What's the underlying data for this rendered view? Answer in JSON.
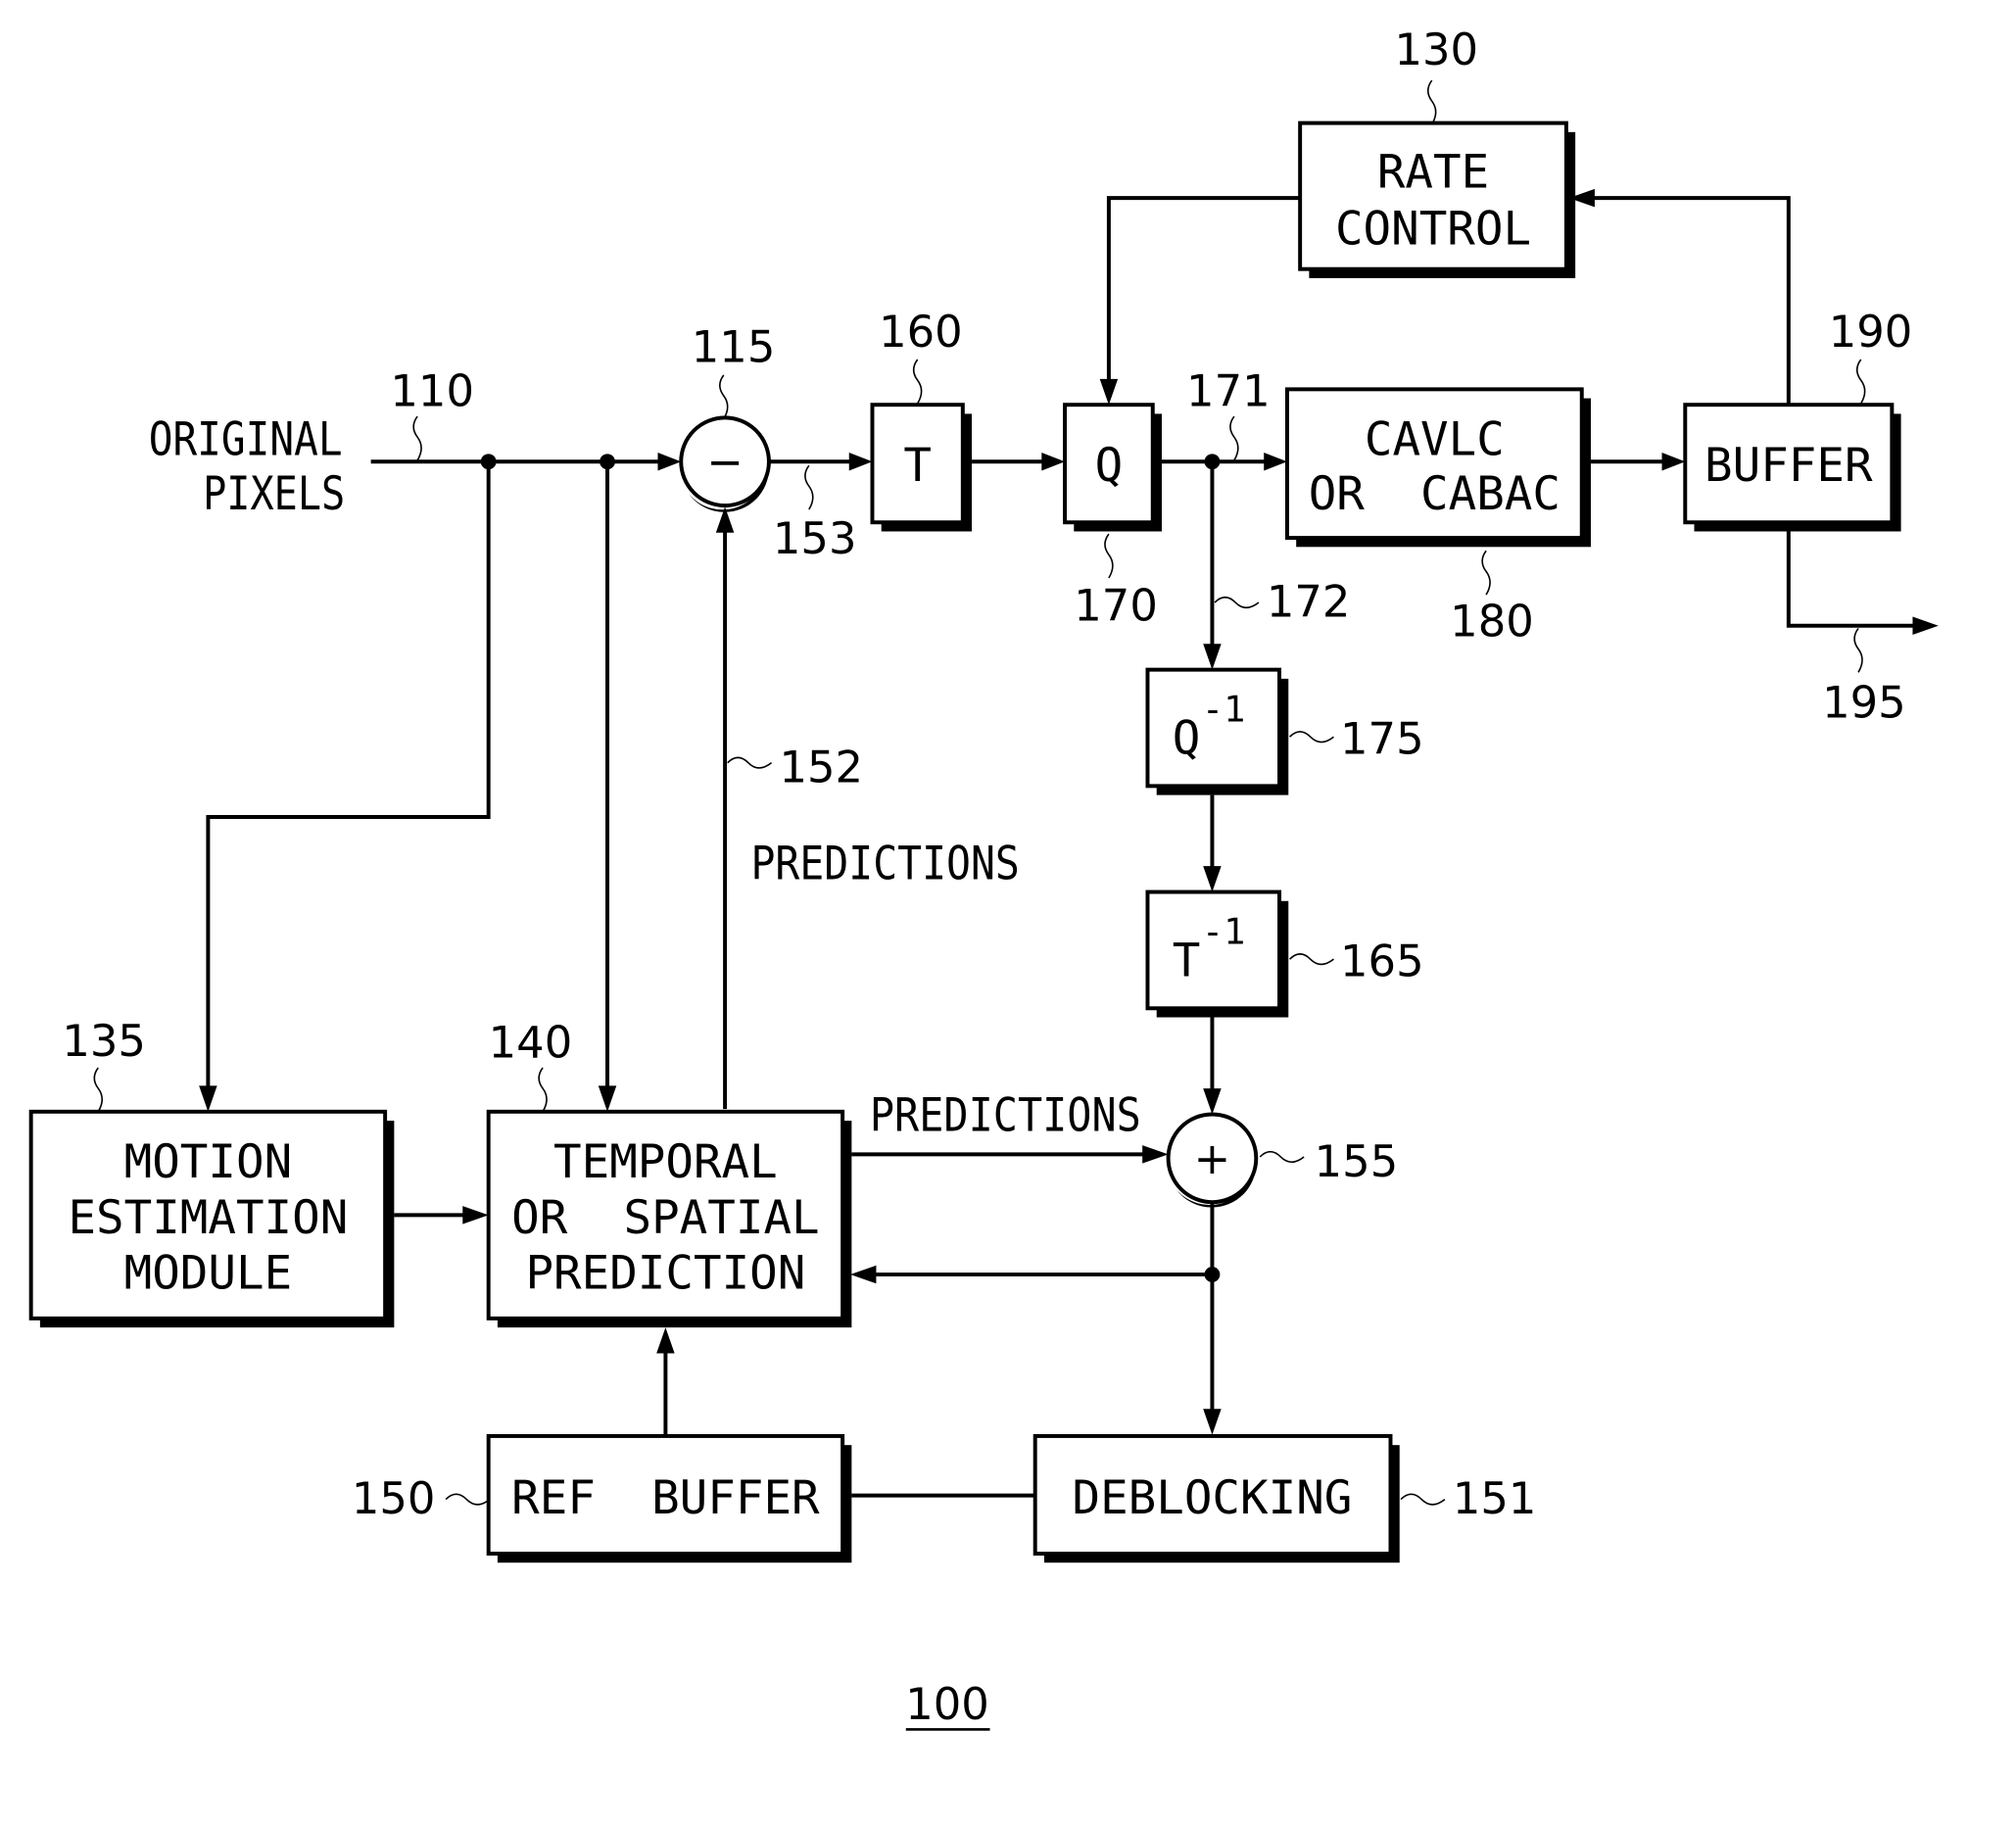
{
  "diagram": {
    "figure_number": "100",
    "input": {
      "line1": "ORIGINAL",
      "line2": "PIXELS",
      "ref": "110"
    },
    "subtractor": {
      "symbol": "−",
      "ref": "115"
    },
    "adder": {
      "symbol": "+",
      "ref": "155"
    },
    "blocks": {
      "transform": {
        "label": "T",
        "ref": "160"
      },
      "quantizer": {
        "label": "Q",
        "ref": "170"
      },
      "entropy": {
        "line1": "CAVLC",
        "line2": "OR  CABAC",
        "ref": "180"
      },
      "buffer": {
        "label": "BUFFER",
        "ref": "190"
      },
      "rate_control": {
        "line1": "RATE",
        "line2": "CONTROL",
        "ref": "130"
      },
      "inv_quantizer": {
        "label": "Q",
        "sup": "-1",
        "ref": "175"
      },
      "inv_transform": {
        "label": "T",
        "sup": "-1",
        "ref": "165"
      },
      "motion_estimation": {
        "line1": "MOTION",
        "line2": "ESTIMATION",
        "line3": "MODULE",
        "ref": "135"
      },
      "prediction": {
        "line1": "TEMPORAL",
        "line2": "OR  SPATIAL",
        "line3": "PREDICTION",
        "ref": "140"
      },
      "ref_buffer": {
        "label": "REF  BUFFER",
        "ref": "150"
      },
      "deblocking": {
        "label": "DEBLOCKING",
        "ref": "151"
      }
    },
    "signals": {
      "predictions_vertical": {
        "label": "PREDICTIONS",
        "ref": "152"
      },
      "predictions_horizontal": {
        "label": "PREDICTIONS"
      },
      "residual": {
        "ref": "153"
      },
      "quantized_out": {
        "ref": "171"
      },
      "quantized_feedback": {
        "ref": "172"
      },
      "bitstream_out": {
        "ref": "195"
      }
    }
  }
}
